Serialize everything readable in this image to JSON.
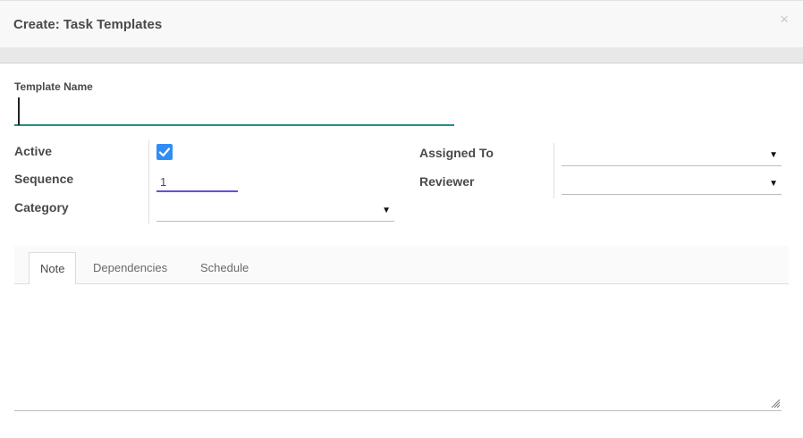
{
  "modal": {
    "title": "Create: Task Templates",
    "close_glyph": "×"
  },
  "form": {
    "template_name_label": "Template Name",
    "template_name_value": "",
    "active_label": "Active",
    "active_checked": true,
    "sequence_label": "Sequence",
    "sequence_value": "1",
    "category_label": "Category",
    "category_value": "",
    "assigned_to_label": "Assigned To",
    "assigned_to_value": "",
    "reviewer_label": "Reviewer",
    "reviewer_value": "",
    "dropdown_glyph": "▼"
  },
  "tabs": [
    {
      "label": "Note",
      "active": true
    },
    {
      "label": "Dependencies",
      "active": false
    },
    {
      "label": "Schedule",
      "active": false
    }
  ],
  "note": {
    "value": ""
  },
  "colors": {
    "checkbox": "#2f8ef5",
    "name_underline": "#1e8f86",
    "sequence_underline": "#6c4ed6"
  },
  "icons": {
    "checkbox": "checkmark-icon",
    "dropdown": "caret-down-icon",
    "resize": "resize-grip-icon",
    "close": "close-icon"
  }
}
